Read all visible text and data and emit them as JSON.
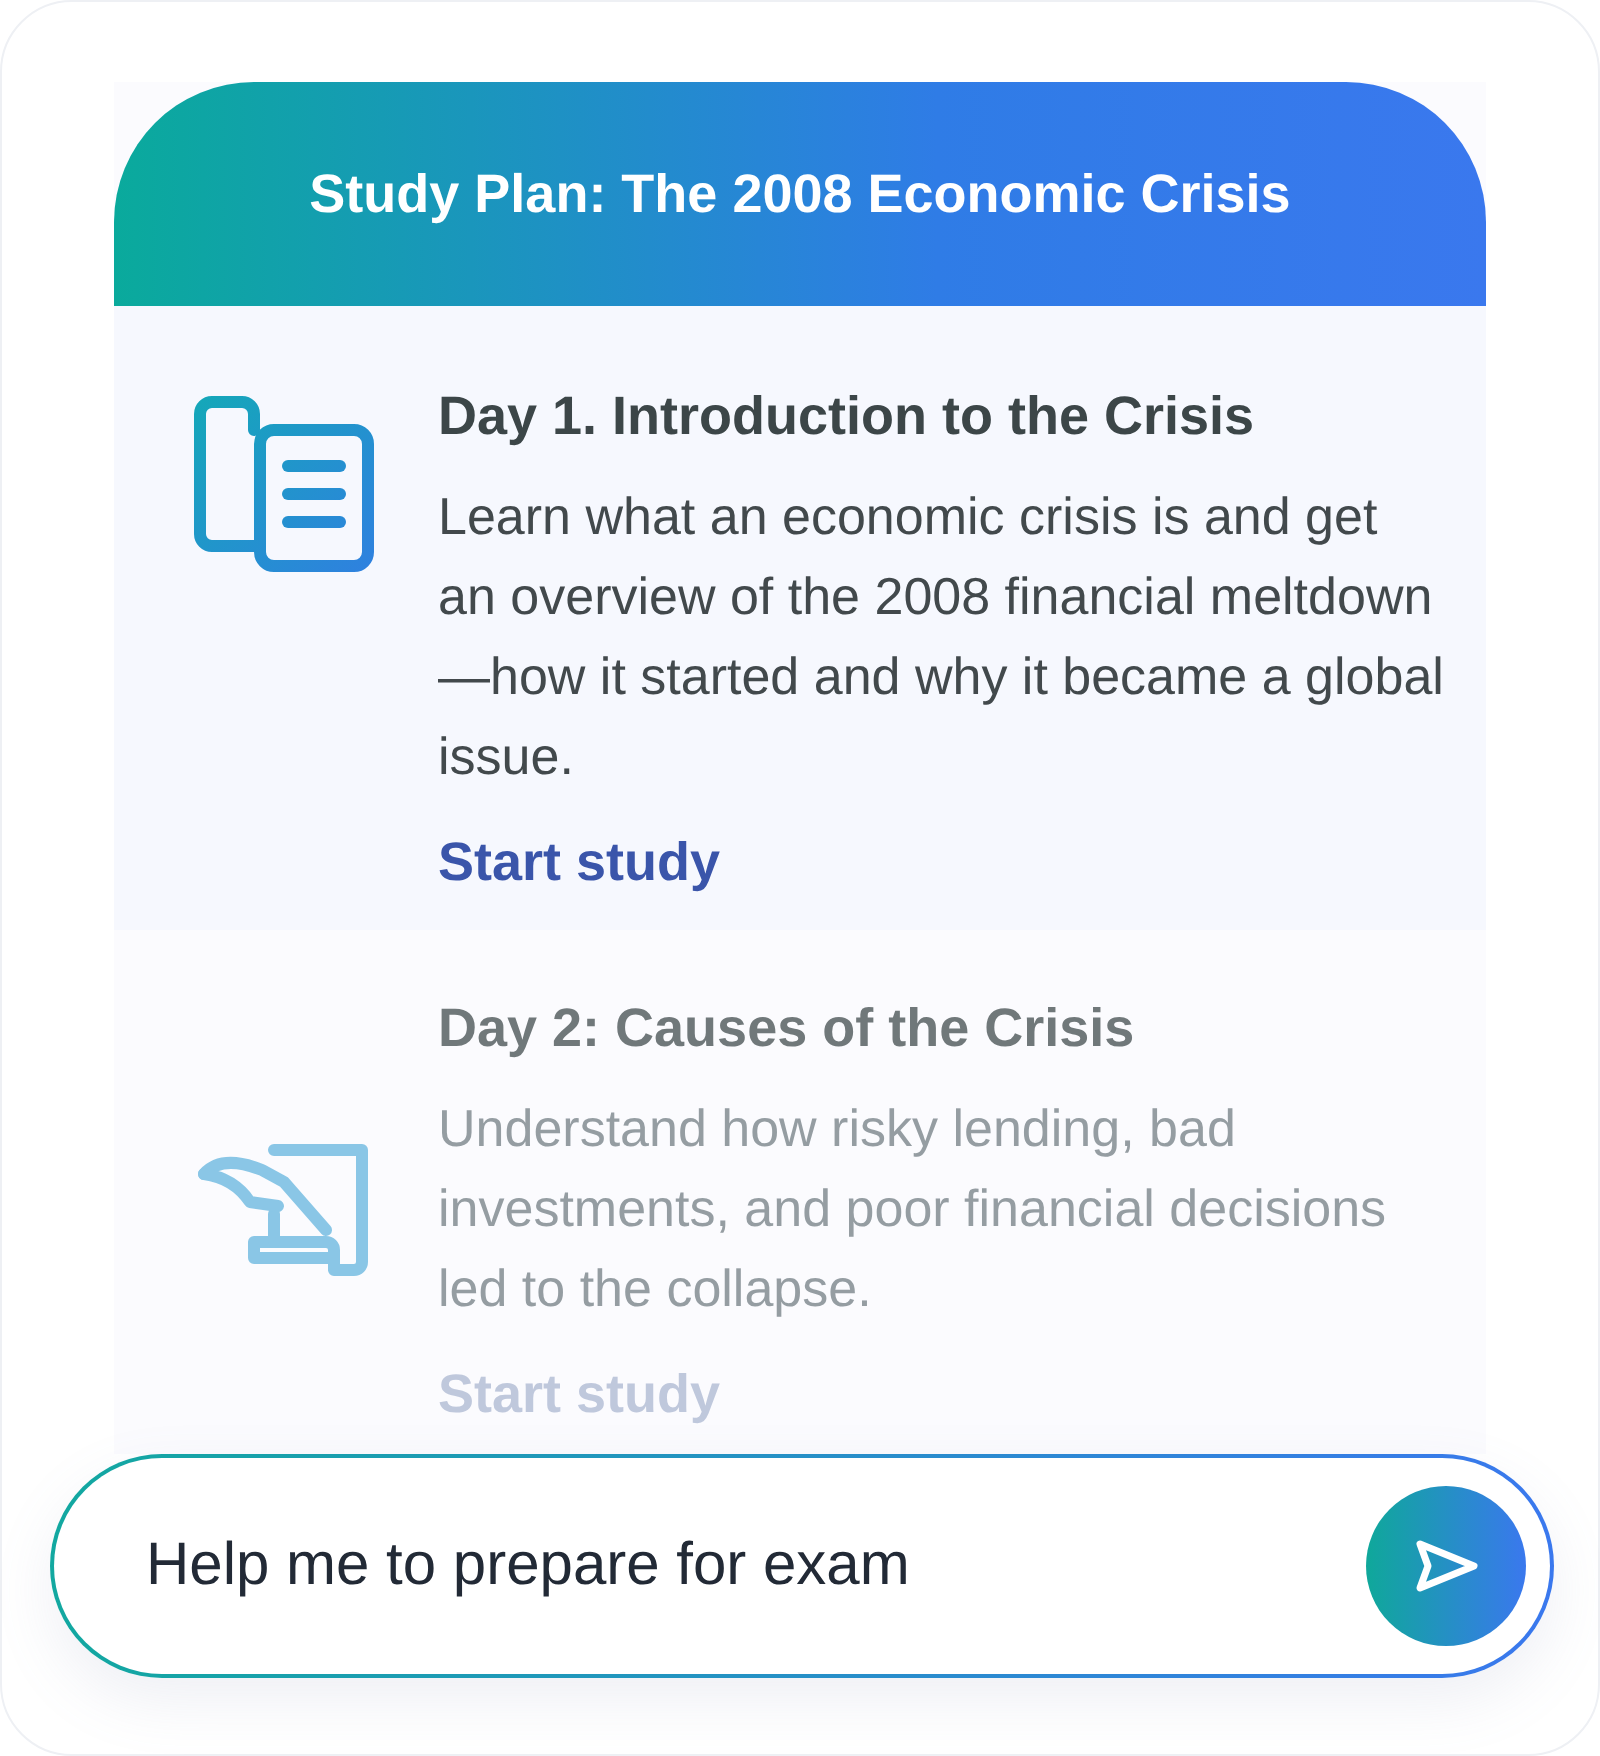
{
  "plan": {
    "title": "Study Plan: The 2008 Economic Crisis",
    "days": [
      {
        "kind": "documents",
        "title": "Day 1. Introduction to the Crisis",
        "description": "Learn what an economic crisis is and get an overview of the 2008 financial meltdown—how it started and why it became a global issue.",
        "action": "Start study",
        "faded": false
      },
      {
        "kind": "quill",
        "title": "Day 2: Causes of the Crisis",
        "description": "Understand how risky lending, bad investments, and poor financial decisions led to the collapse.",
        "action": "Start study",
        "faded": true
      }
    ]
  },
  "prompt": {
    "value": "Help me to prepare for exam"
  }
}
